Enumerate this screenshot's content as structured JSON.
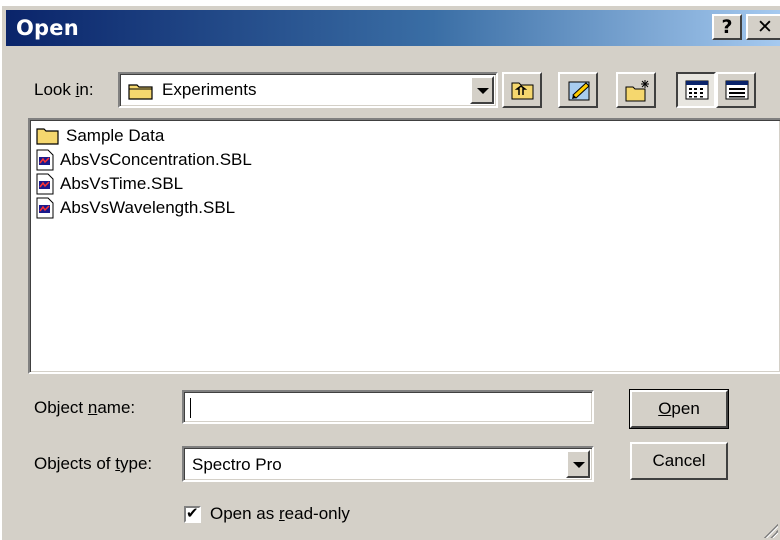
{
  "window": {
    "title": "Open",
    "help_button": "?",
    "close_button": "✕"
  },
  "look_in": {
    "label_pre": "Look ",
    "label_accel": "i",
    "label_post": "n:",
    "value": "Experiments"
  },
  "toolbar": {
    "icons": [
      "up-one-level-icon",
      "edit-icon",
      "new-folder-icon",
      "list-view-icon",
      "details-view-icon"
    ]
  },
  "files": [
    {
      "name": "Sample Data",
      "icon": "folder-icon"
    },
    {
      "name": "AbsVsConcentration.SBL",
      "icon": "document-icon"
    },
    {
      "name": "AbsVsTime.SBL",
      "icon": "document-icon"
    },
    {
      "name": "AbsVsWavelength.SBL",
      "icon": "document-icon"
    }
  ],
  "object_name": {
    "label_pre": "Object ",
    "label_accel": "n",
    "label_post": "ame:",
    "value": ""
  },
  "object_type": {
    "label_pre": "Objects of ",
    "label_accel": "t",
    "label_post": "ype:",
    "value": "Spectro Pro"
  },
  "read_only": {
    "checked": true,
    "check_mark": "✔",
    "label_pre": "Open as ",
    "label_accel": "r",
    "label_post": "ead-only"
  },
  "buttons": {
    "open_accel": "O",
    "open_rest": "pen",
    "cancel": "Cancel"
  }
}
